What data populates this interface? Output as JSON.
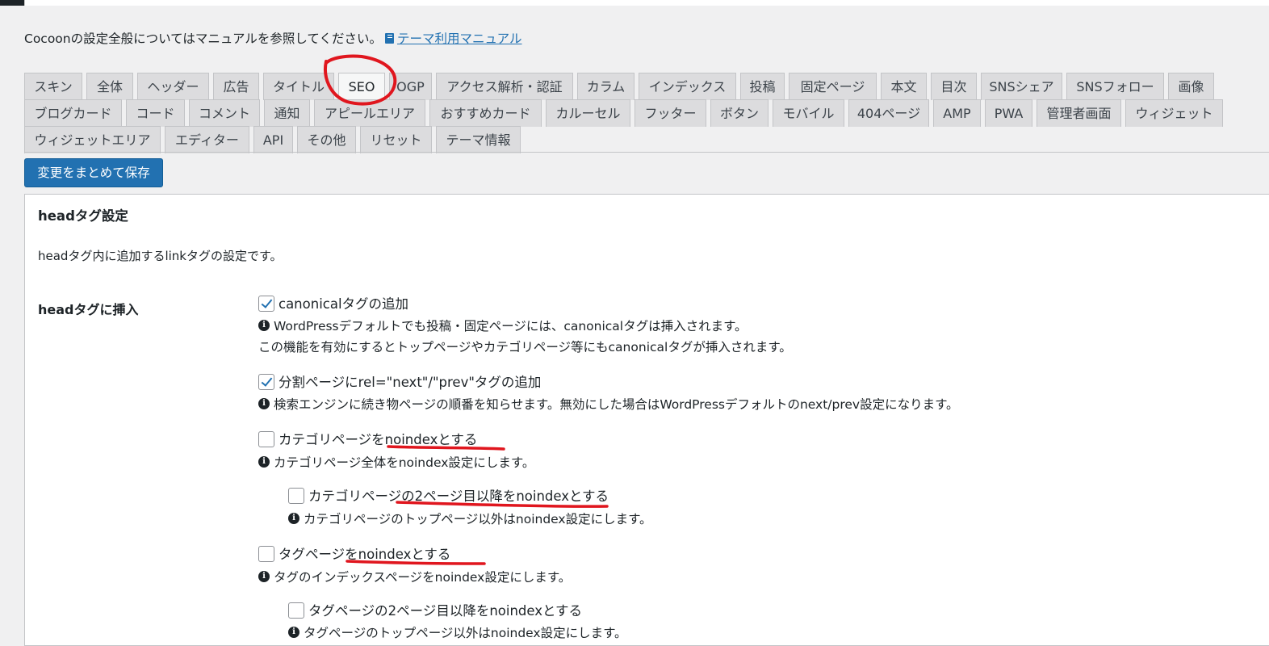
{
  "intro": {
    "text": "Cocoonの設定全般についてはマニュアルを参照してください。",
    "link": "テーマ利用マニュアル"
  },
  "tabs": [
    [
      "スキン",
      "全体",
      "ヘッダー",
      "広告",
      "タイトル",
      "SEO",
      "OGP",
      "アクセス解析・認証",
      "カラム",
      "インデックス",
      "投稿",
      "固定ページ",
      "本文",
      "目次",
      "SNSシェア",
      "SNSフォロー",
      "画像"
    ],
    [
      "ブログカード",
      "コード",
      "コメント",
      "通知",
      "アピールエリア",
      "おすすめカード",
      "カルーセル",
      "フッター",
      "ボタン",
      "モバイル",
      "404ページ",
      "AMP",
      "PWA",
      "管理者画面",
      "ウィジェット"
    ],
    [
      "ウィジェットエリア",
      "エディター",
      "API",
      "その他",
      "リセット",
      "テーマ情報"
    ]
  ],
  "active_tab": "SEO",
  "save_button": "変更をまとめて保存",
  "section": {
    "title": "headタグ設定",
    "description": "headタグ内に追加するlinkタグの設定です。",
    "row_label": "headタグに挿入"
  },
  "options": {
    "canonical": {
      "label": "canonicalタグの追加",
      "checked": true,
      "note1": "WordPressデフォルトでも投稿・固定ページには、canonicalタグは挿入されます。",
      "note2": "この機能を有効にするとトップページやカテゴリページ等にもcanonicalタグが挿入されます。"
    },
    "next_prev": {
      "label": "分割ページにrel=\"next\"/\"prev\"タグの追加",
      "checked": true,
      "note": "検索エンジンに続き物ページの順番を知らせます。無効にした場合はWordPressデフォルトのnext/prev設定になります。"
    },
    "category_noindex": {
      "label": "カテゴリページをnoindexとする",
      "checked": false,
      "note": "カテゴリページ全体をnoindex設定にします。"
    },
    "category_paged_noindex": {
      "label": "カテゴリページの2ページ目以降をnoindexとする",
      "checked": false,
      "note": "カテゴリページのトップページ以外はnoindex設定にします。"
    },
    "tag_noindex": {
      "label": "タグページをnoindexとする",
      "checked": false,
      "note": "タグのインデックスページをnoindex設定にします。"
    },
    "tag_paged_noindex": {
      "label": "タグページの2ページ目以降をnoindexとする",
      "checked": false,
      "note": "タグページのトップページ以外はnoindex設定にします。"
    }
  },
  "icons": {
    "info": "info-icon",
    "book": "book-icon",
    "check": "check-icon"
  },
  "colors": {
    "accent": "#2271b1",
    "annotation": "#e0161e",
    "tab_bg": "#dcdcde",
    "panel_bg": "#ffffff",
    "page_bg": "#f0f0f1"
  }
}
